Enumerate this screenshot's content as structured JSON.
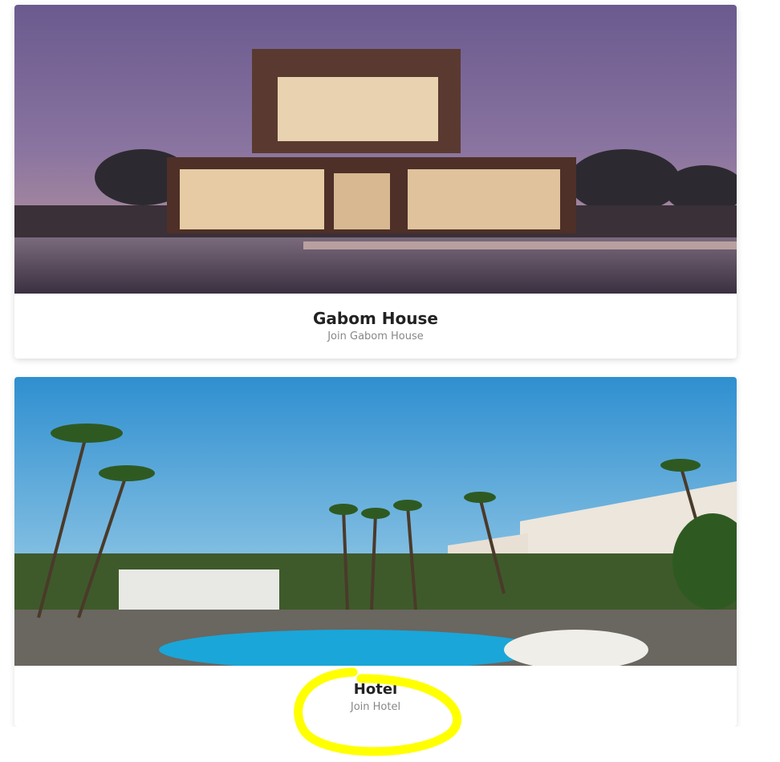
{
  "cards": [
    {
      "title": "Gabom House",
      "subtitle": "Join Gabom House",
      "image": "modern-house-with-pool"
    },
    {
      "title": "Hotel",
      "subtitle": "Join Hotel",
      "image": "resort-hotel-pool-palms"
    }
  ],
  "annotation": {
    "color": "#ffff00",
    "shape": "hand-drawn-circle"
  }
}
